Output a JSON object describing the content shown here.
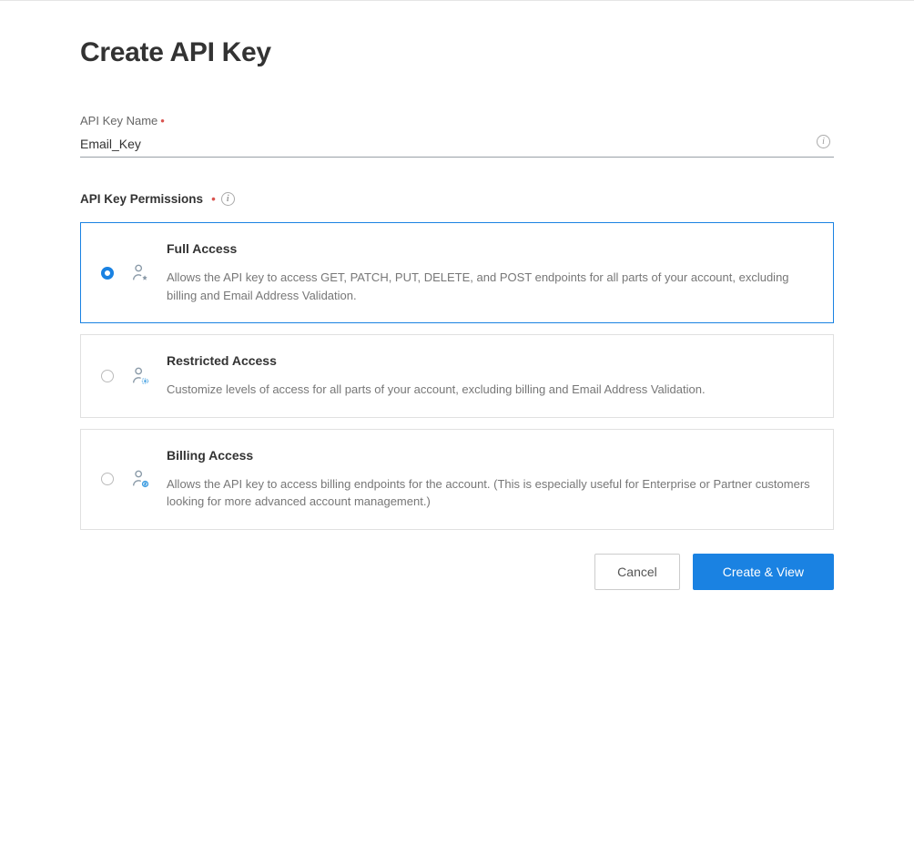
{
  "page": {
    "title": "Create API Key"
  },
  "form": {
    "name_label": "API Key Name",
    "name_value": "Email_Key",
    "permissions_label": "API Key Permissions"
  },
  "options": {
    "full": {
      "title": "Full Access",
      "desc": "Allows the API key to access GET, PATCH, PUT, DELETE, and POST endpoints for all parts of your account, excluding billing and Email Address Validation.",
      "selected": true
    },
    "restricted": {
      "title": "Restricted Access",
      "desc": "Customize levels of access for all parts of your account, excluding billing and Email Address Validation.",
      "selected": false
    },
    "billing": {
      "title": "Billing Access",
      "desc": "Allows the API key to access billing endpoints for the account. (This is especially useful for Enterprise or Partner customers looking for more advanced account management.)",
      "selected": false
    }
  },
  "actions": {
    "cancel": "Cancel",
    "create": "Create & View"
  }
}
